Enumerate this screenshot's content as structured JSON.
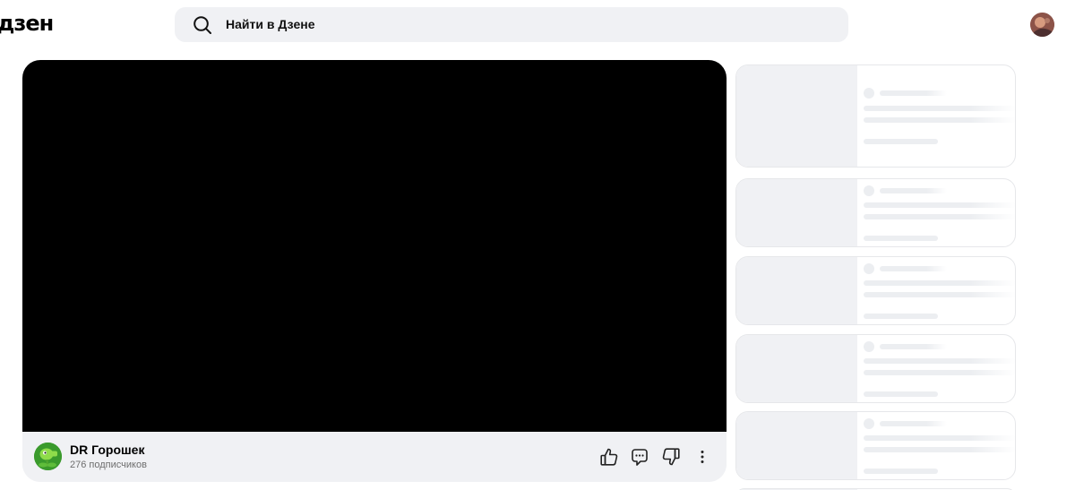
{
  "header": {
    "logo_text": "дзен",
    "search": {
      "placeholder": "Найти в Дзене"
    }
  },
  "video": {
    "channel": {
      "name": "DR Горошек",
      "subscribers": "276 подписчиков"
    },
    "actions": [
      "like-icon",
      "comments-icon",
      "dislike-icon",
      "more-icon"
    ]
  },
  "recommendations": {
    "state": "loading",
    "skeleton_cards": 5
  },
  "colors": {
    "search_bg": "#f0f1f4",
    "video_bg": "#000000",
    "info_bar_bg": "#f0f1f4",
    "skeleton": "#eceef1"
  }
}
